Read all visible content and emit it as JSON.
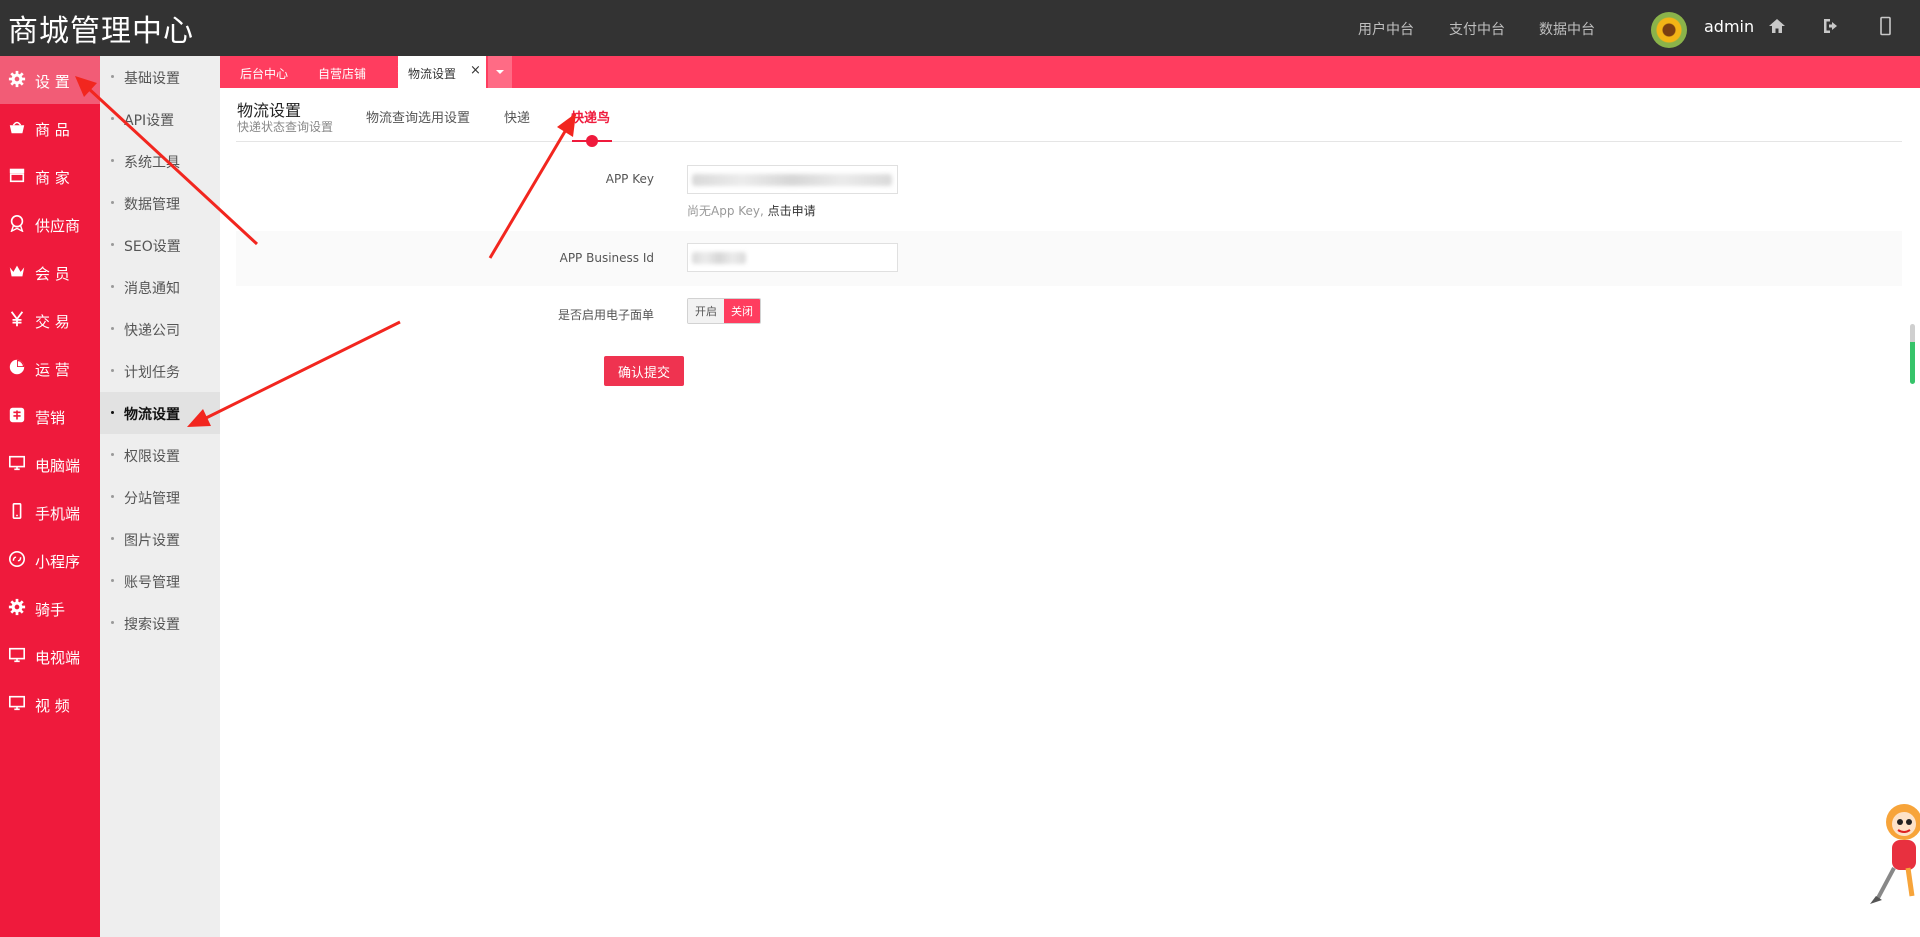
{
  "app": {
    "title": "商城管理中心"
  },
  "topnav": [
    {
      "label": "用户中台"
    },
    {
      "label": "支付中台"
    },
    {
      "label": "数据中台"
    }
  ],
  "user": {
    "name": "admin"
  },
  "top_icons": [
    "home-icon",
    "logout-icon",
    "fullscreen-icon"
  ],
  "sidebar": {
    "items": [
      {
        "label": "设 置",
        "icon": "gear-icon",
        "active": true
      },
      {
        "label": "商 品",
        "icon": "basket-icon"
      },
      {
        "label": "商 家",
        "icon": "store-icon"
      },
      {
        "label": "供应商",
        "icon": "supplier-icon"
      },
      {
        "label": "会 员",
        "icon": "crown-icon"
      },
      {
        "label": "交 易",
        "icon": "yen-icon"
      },
      {
        "label": "运 营",
        "icon": "pie-icon"
      },
      {
        "label": "营销",
        "icon": "marketing-icon"
      },
      {
        "label": "电脑端",
        "icon": "monitor-icon"
      },
      {
        "label": "手机端",
        "icon": "mobile-icon"
      },
      {
        "label": "小程序",
        "icon": "miniprogram-icon"
      },
      {
        "label": "骑手",
        "icon": "gear-icon"
      },
      {
        "label": "电视端",
        "icon": "monitor-icon"
      },
      {
        "label": "视 频",
        "icon": "monitor-icon"
      }
    ]
  },
  "submenu": {
    "items": [
      {
        "label": "基础设置"
      },
      {
        "label": "API设置"
      },
      {
        "label": "系统工具"
      },
      {
        "label": "数据管理"
      },
      {
        "label": "SEO设置"
      },
      {
        "label": "消息通知"
      },
      {
        "label": "快递公司"
      },
      {
        "label": "计划任务"
      },
      {
        "label": "物流设置",
        "active": true
      },
      {
        "label": "权限设置"
      },
      {
        "label": "分站管理"
      },
      {
        "label": "图片设置"
      },
      {
        "label": "账号管理"
      },
      {
        "label": "搜索设置"
      }
    ]
  },
  "tabs": [
    {
      "label": "后台中心",
      "closable": false
    },
    {
      "label": "自营店铺",
      "closable": true
    },
    {
      "label": "物流设置",
      "closable": true,
      "active": true
    }
  ],
  "tab_close_glyph": "×",
  "page": {
    "title": "物流设置",
    "subtitle": "快递状态查询设置",
    "subtabs": [
      {
        "label": "物流查询选用设置"
      },
      {
        "label": "快递"
      },
      {
        "label": "快递鸟",
        "active": true
      }
    ]
  },
  "form": {
    "app_key_label": "APP Key",
    "hint_prefix": "尚无App Key, ",
    "hint_link": "点击申请",
    "business_id_label": "APP Business Id",
    "waybill_label": "是否启用电子面单",
    "toggle_on": "开启",
    "toggle_off": "关闭",
    "toggle_selected": "关闭",
    "submit_label": "确认提交"
  },
  "colors": {
    "brand_red": "#ef1a3c",
    "tab_red": "#ff3d5f",
    "topbar": "#333333",
    "submenu_bg": "#eeeeee"
  }
}
